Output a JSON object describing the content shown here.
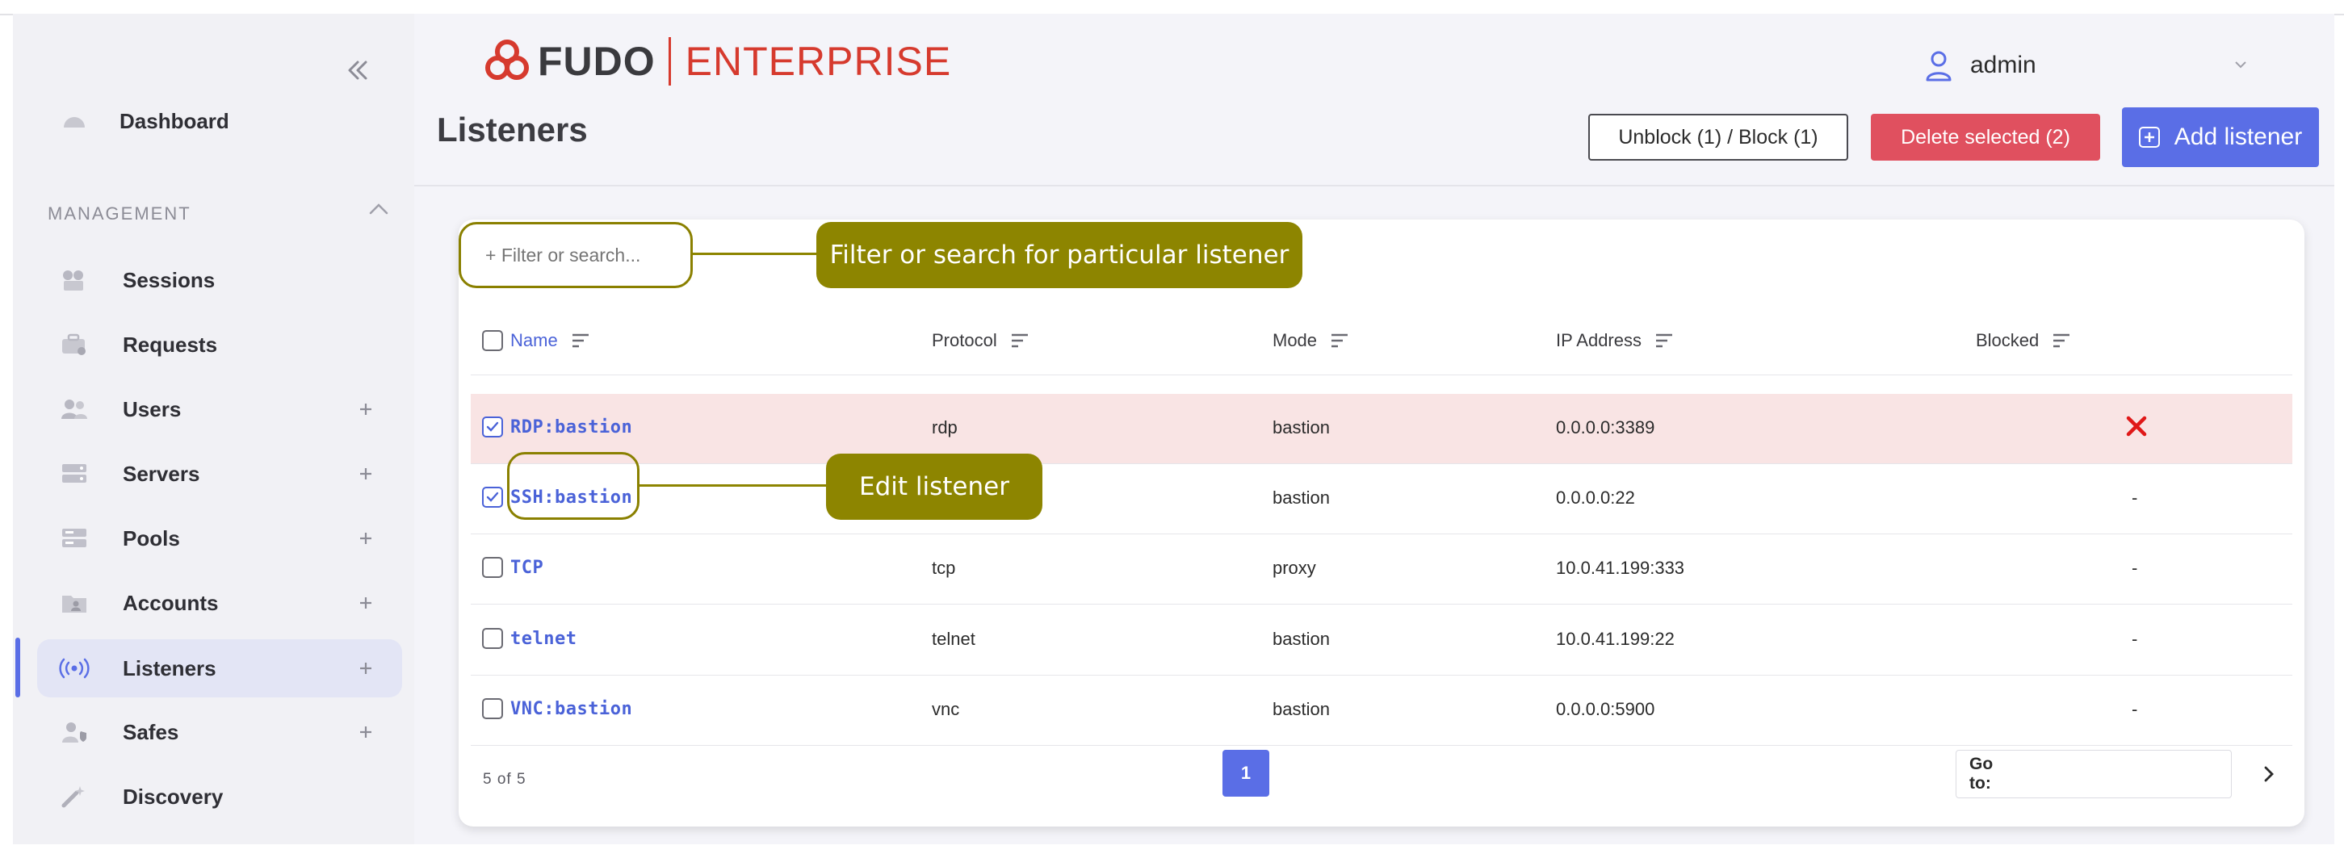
{
  "header": {
    "logo_brand": "FUDO",
    "logo_edition": "ENTERPRISE",
    "user_name": "admin"
  },
  "sidebar": {
    "section_title": "MANAGEMENT",
    "items": [
      {
        "label": "Dashboard",
        "icon": "dashboard-icon",
        "has_plus": false,
        "active": false
      },
      {
        "label": "Sessions",
        "icon": "sessions-icon",
        "has_plus": false,
        "active": false
      },
      {
        "label": "Requests",
        "icon": "requests-icon",
        "has_plus": false,
        "active": false
      },
      {
        "label": "Users",
        "icon": "users-icon",
        "has_plus": true,
        "active": false
      },
      {
        "label": "Servers",
        "icon": "servers-icon",
        "has_plus": true,
        "active": false
      },
      {
        "label": "Pools",
        "icon": "pools-icon",
        "has_plus": true,
        "active": false
      },
      {
        "label": "Accounts",
        "icon": "accounts-icon",
        "has_plus": true,
        "active": false
      },
      {
        "label": "Listeners",
        "icon": "listeners-icon",
        "has_plus": true,
        "active": true
      },
      {
        "label": "Safes",
        "icon": "safes-icon",
        "has_plus": true,
        "active": false
      },
      {
        "label": "Discovery",
        "icon": "discovery-icon",
        "has_plus": false,
        "active": false
      }
    ]
  },
  "page": {
    "title": "Listeners",
    "unblock_label": "Unblock (1) / Block (1)",
    "delete_label": "Delete selected (2)",
    "add_label": "Add listener"
  },
  "filter": {
    "placeholder": "+ Filter or search..."
  },
  "callouts": {
    "filter": "Filter or search for particular listener",
    "edit": "Edit listener"
  },
  "table": {
    "columns": [
      "Name",
      "Protocol",
      "Mode",
      "IP Address",
      "Blocked"
    ],
    "rows": [
      {
        "name": "RDP:bastion",
        "protocol": "rdp",
        "mode": "bastion",
        "ip": "0.0.0.0:3389",
        "blocked": "",
        "is_blocked": true,
        "checked": true
      },
      {
        "name": "SSH:bastion",
        "protocol": "",
        "mode": "bastion",
        "ip": "0.0.0.0:22",
        "blocked": "-",
        "is_blocked": false,
        "checked": true
      },
      {
        "name": "TCP",
        "protocol": "tcp",
        "mode": "proxy",
        "ip": "10.0.41.199:333",
        "blocked": "-",
        "is_blocked": false,
        "checked": false
      },
      {
        "name": "telnet",
        "protocol": "telnet",
        "mode": "bastion",
        "ip": "10.0.41.199:22",
        "blocked": "-",
        "is_blocked": false,
        "checked": false
      },
      {
        "name": "VNC:bastion",
        "protocol": "vnc",
        "mode": "bastion",
        "ip": "0.0.0.0:5900",
        "blocked": "-",
        "is_blocked": false,
        "checked": false
      }
    ]
  },
  "pager": {
    "count": "5 of 5",
    "current_page": "1",
    "goto_label": "Go to:"
  },
  "colors": {
    "accent": "#5a6ee6",
    "danger": "#e0505f",
    "brand_red": "#d63a2e",
    "callout": "#8d8500",
    "blocked_row": "#f9e4e4"
  }
}
